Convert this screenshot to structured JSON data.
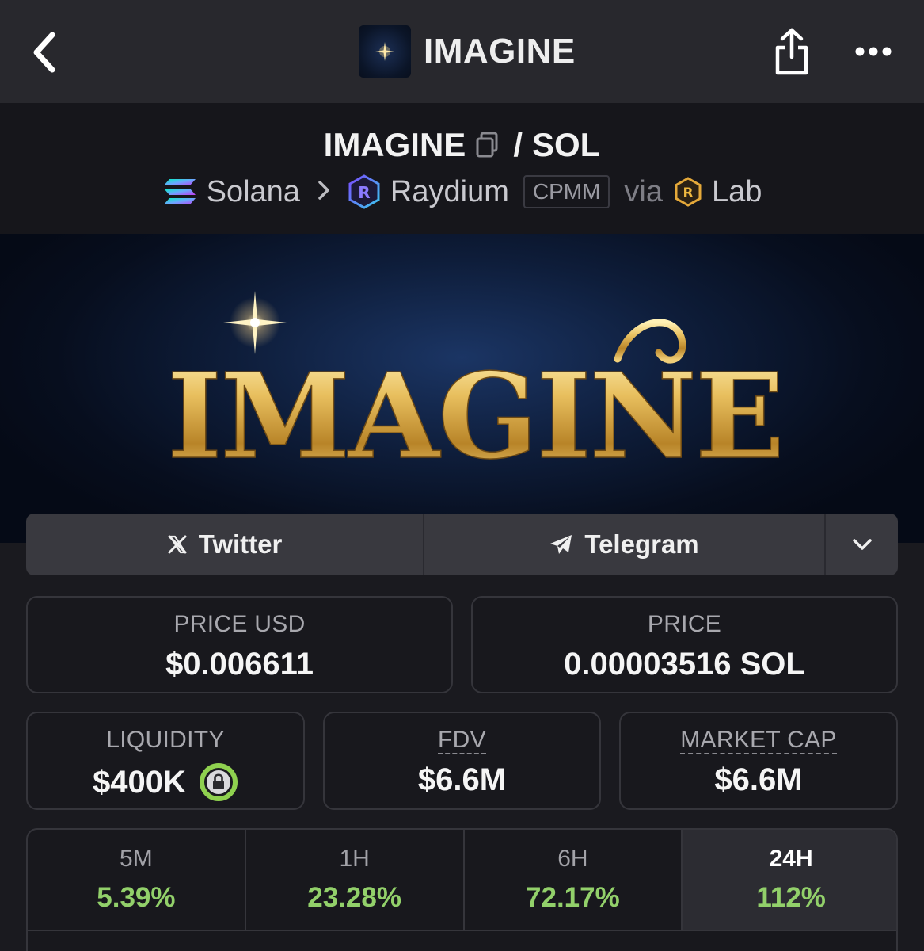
{
  "nav": {
    "title": "IMAGINE"
  },
  "pair": {
    "base": "IMAGINE",
    "separator": "/",
    "quote": "SOL",
    "chain": "Solana",
    "dex": "Raydium",
    "pool_type": "CPMM",
    "via_label": "via",
    "launchpad": "Lab"
  },
  "banner": {
    "logo_text": "IMAGINE"
  },
  "socials": {
    "twitter": "Twitter",
    "telegram": "Telegram"
  },
  "stats": {
    "price_usd_label": "PRICE USD",
    "price_usd": "$0.006611",
    "price_label": "PRICE",
    "price_sol": "0.00003516 SOL",
    "liquidity_label": "LIQUIDITY",
    "liquidity": "$400K",
    "fdv_label": "FDV",
    "fdv": "$6.6M",
    "market_cap_label": "MARKET CAP",
    "market_cap": "$6.6M"
  },
  "timeframes": [
    {
      "label": "5M",
      "change": "5.39%"
    },
    {
      "label": "1H",
      "change": "23.28%"
    },
    {
      "label": "6H",
      "change": "72.17%"
    },
    {
      "label": "24H",
      "change": "112%"
    }
  ],
  "colors": {
    "positive": "#92d06a",
    "lock_ring": "#8fd14f",
    "gold": "#e0b458"
  }
}
